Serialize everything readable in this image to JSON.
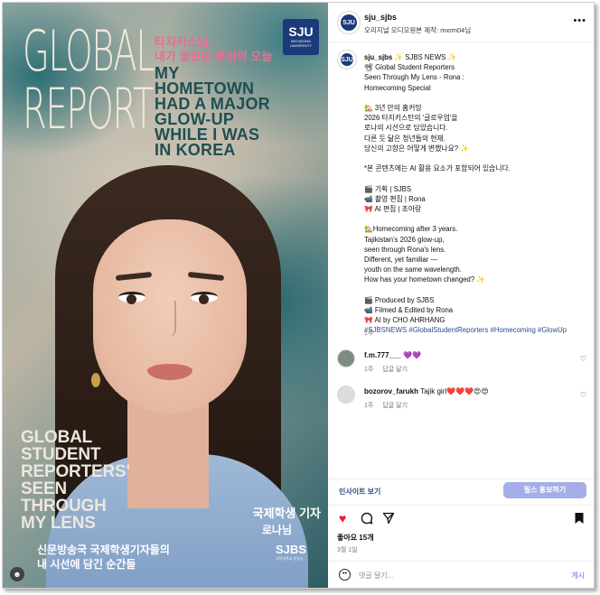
{
  "media": {
    "big_title": [
      "GLOBAL",
      "REPORT"
    ],
    "kr_headline": [
      "타지키스탄,",
      "내가 몰랐던 룻밖의 오늘"
    ],
    "en_headline": [
      "MY",
      "HOMETOWN",
      "HAD A MAJOR",
      "GLOW-UP",
      "WHILE I WAS",
      "IN KOREA"
    ],
    "sju_logo": {
      "mark": "SJU",
      "sub": "SEOJEONG UNIVERSITY"
    },
    "bottom_title": [
      "GLOBAL",
      "STUDENT",
      "REPORTERS'",
      "SEEN",
      "THROUGH",
      "MY LENS"
    ],
    "reporter_kr": "국제학생 기자",
    "reporter_name": "로나님",
    "caption_kr": [
      "신문방송국 국제학생기자들의",
      "내 시선에 담긴 순간들"
    ],
    "sjbs_logo": {
      "mark": "SJBS",
      "sub": "서정대학교 방송국"
    }
  },
  "header": {
    "username": "sju_sjbs",
    "subtitle": "오리지널 오디오원본 제작: mxrm04님",
    "avatar_text": "SJU"
  },
  "caption": {
    "username": "sju_sjbs",
    "text": "✨ SJBS NEWS ✨\n📽 Global Student Reporters\nSeen Through My Lens - Rona :\nHomecoming Special\n\n🏡 3년 만의 홈커밍\n2026 타지키스탄의 '글로우업'을\n로나의 시선으로 담았습니다.\n다른 듯 닮은 청년들의 현재.\n당신의 고향은 어떻게 변했나요? ✨\n\n*본 콘텐츠에는 AI 활용 요소가 포함되어 있습니다.\n\n🎬 기획 | SJBS\n📹 촬영 편집 | Rona\n🎀 AI 편집 | 조아랑\n\n🏡Homecoming after 3 years.\nTajikistan's 2026 glow-up,\nseen through Rona's lens.\nDifferent, yet familiar —\nyouth on the same wavelength.\nHow has your hometown changed? ✨\n\n🎬 Produced by SJBS\n📹 Filmed & Edited by Rona\n🎀 AI by CHO AHRHANG\n",
    "hashtags": "#SJBSNEWS #GlobalStudentReporters #Homecoming #GlowUp",
    "time": "1주"
  },
  "comments": [
    {
      "username": "f.m.777___",
      "text": "💜💜",
      "time": "1주",
      "reply_label": "답글 달기"
    },
    {
      "username": "bozorov_farukh",
      "text": "Tajik girl❤️❤️❤️😍😍",
      "time": "1주",
      "reply_label": "답글 달기"
    }
  ],
  "insight": {
    "link_label": "인사이트 보기",
    "boost_label": "릴스 홍보하기"
  },
  "actions": {
    "likes": "좋아요 15개",
    "date": "3월 1일"
  },
  "comment_box": {
    "placeholder": "댓글 달기...",
    "post_label": "게시"
  },
  "colors": {
    "like_red": "#ed1c24",
    "link_blue": "#2b4e8a",
    "boost_button": "#a4aee8",
    "kr_headline_pink": "#f06a93",
    "en_headline_teal": "#1f4f53"
  }
}
